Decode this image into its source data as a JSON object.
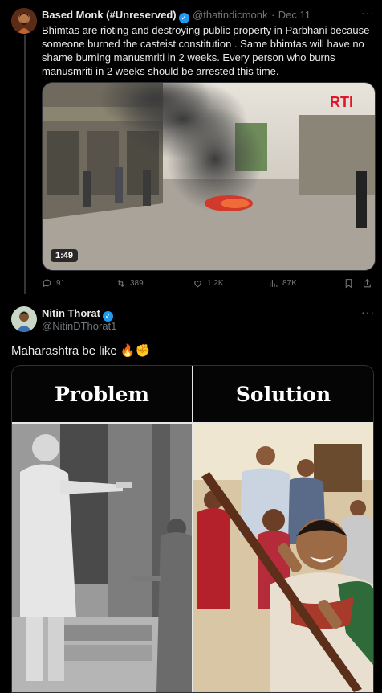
{
  "tweet1": {
    "author": "Based Monk (#Unreserved)",
    "handle": "@thatindicmonk",
    "separator": "·",
    "date": "Dec 11",
    "text": "Bhimtas are rioting and destroying public property in Parbhani because someone burned the casteist constitution . Same bhimtas will have no shame burning manusmriti in 2 weeks. Every person who burns manusmriti in 2 weeks should be arrested this time.",
    "video_duration": "1:49",
    "video_watermark": "RTI",
    "replies": "91",
    "reposts": "389",
    "likes": "1.2K",
    "views": "87K"
  },
  "tweet2": {
    "author": "Nitin Thorat",
    "handle": "@NitinDThorat1",
    "text": "Maharashtra be like",
    "emoji": "🔥✊",
    "meme": {
      "left_heading": "Problem",
      "right_heading": "Solution"
    }
  },
  "icons": {
    "verified": "verified-badge-icon",
    "more": "more-icon",
    "reply": "reply-icon",
    "repost": "repost-icon",
    "like": "like-icon",
    "views": "views-icon",
    "bookmark": "bookmark-icon",
    "share": "share-icon"
  },
  "colors": {
    "background": "#000000",
    "text": "#e7e9ea",
    "muted": "#71767b",
    "verified": "#1d9bf0"
  }
}
